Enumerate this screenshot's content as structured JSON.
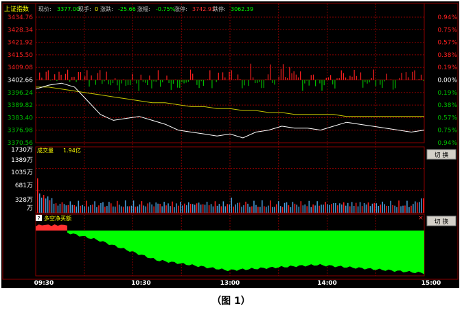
{
  "header": {
    "index_name": "上证指数",
    "current_label": "现价:",
    "current_value": "3377.00",
    "volume_label": "现手:",
    "volume_value": "0",
    "change_label": "涨跌:",
    "change_value": "-25.66",
    "change_pct_label": "涨幅:",
    "change_pct_value": "-0.75%",
    "limit_up_label": "涨停:",
    "limit_up_value": "3742.93",
    "limit_down_label": "跌停:",
    "limit_down_value": "3062.39"
  },
  "colors": {
    "background": "#000000",
    "grid": "#8b0000",
    "up": "#ff2020",
    "down": "#00c000",
    "price_line": "#ffffff",
    "avg_line": "#c8c800",
    "volume_bar": "#4a9bd8",
    "fill_green": "#00ff00",
    "fill_red": "#ff3030",
    "yellow_text": "#ffff00"
  },
  "price_axis": {
    "left_labels": [
      "3434.76",
      "3428.34",
      "3421.92",
      "3415.50",
      "3409.08",
      "3402.66",
      "3396.24",
      "3389.82",
      "3383.40",
      "3376.98",
      "3370.56"
    ],
    "right_labels": [
      "0.94%",
      "0.75%",
      "0.57%",
      "0.38%",
      "0.19%",
      "0.00%",
      "0.19%",
      "0.38%",
      "0.57%",
      "0.75%",
      "0.94%"
    ],
    "base": 3402.66
  },
  "volume_panel": {
    "title": "成交量",
    "total": "1.94亿",
    "labels": [
      "1730万",
      "1389万",
      "1035万",
      "681万",
      "328万",
      "万"
    ],
    "switch_button": "切 换"
  },
  "indicator_panel": {
    "help_icon_text": "?",
    "title": "多空净买额",
    "switch_button": "切 换",
    "close_icon": "×"
  },
  "time_axis": {
    "labels": [
      "09:30",
      "10:30",
      "13:00",
      "14:00",
      "15:00"
    ]
  },
  "caption": "（图 1）",
  "chart_data": {
    "type": "line",
    "x_ticks": [
      "09:30",
      "10:30",
      "13:00",
      "14:00",
      "15:00"
    ],
    "ylim": [
      3370.56,
      3434.76
    ],
    "series": [
      {
        "values": [
          3398,
          3400,
          3401,
          3399,
          3392,
          3385,
          3382,
          3383,
          3384,
          3382,
          3380,
          3377,
          3376,
          3375,
          3374,
          3375,
          3373,
          3376,
          3377,
          3379,
          3378,
          3378,
          3377,
          3379,
          3381,
          3380,
          3379,
          3378,
          3377,
          3376,
          3377
        ]
      },
      {
        "values": [
          3399,
          3399,
          3398,
          3397,
          3396,
          3395,
          3394,
          3393,
          3392,
          3391,
          3391,
          3390,
          3389,
          3389,
          3388,
          3388,
          3387,
          3387,
          3386,
          3386,
          3385,
          3385,
          3385,
          3385,
          3384,
          3384,
          3384,
          3384,
          3384,
          3384,
          3384
        ]
      }
    ]
  }
}
